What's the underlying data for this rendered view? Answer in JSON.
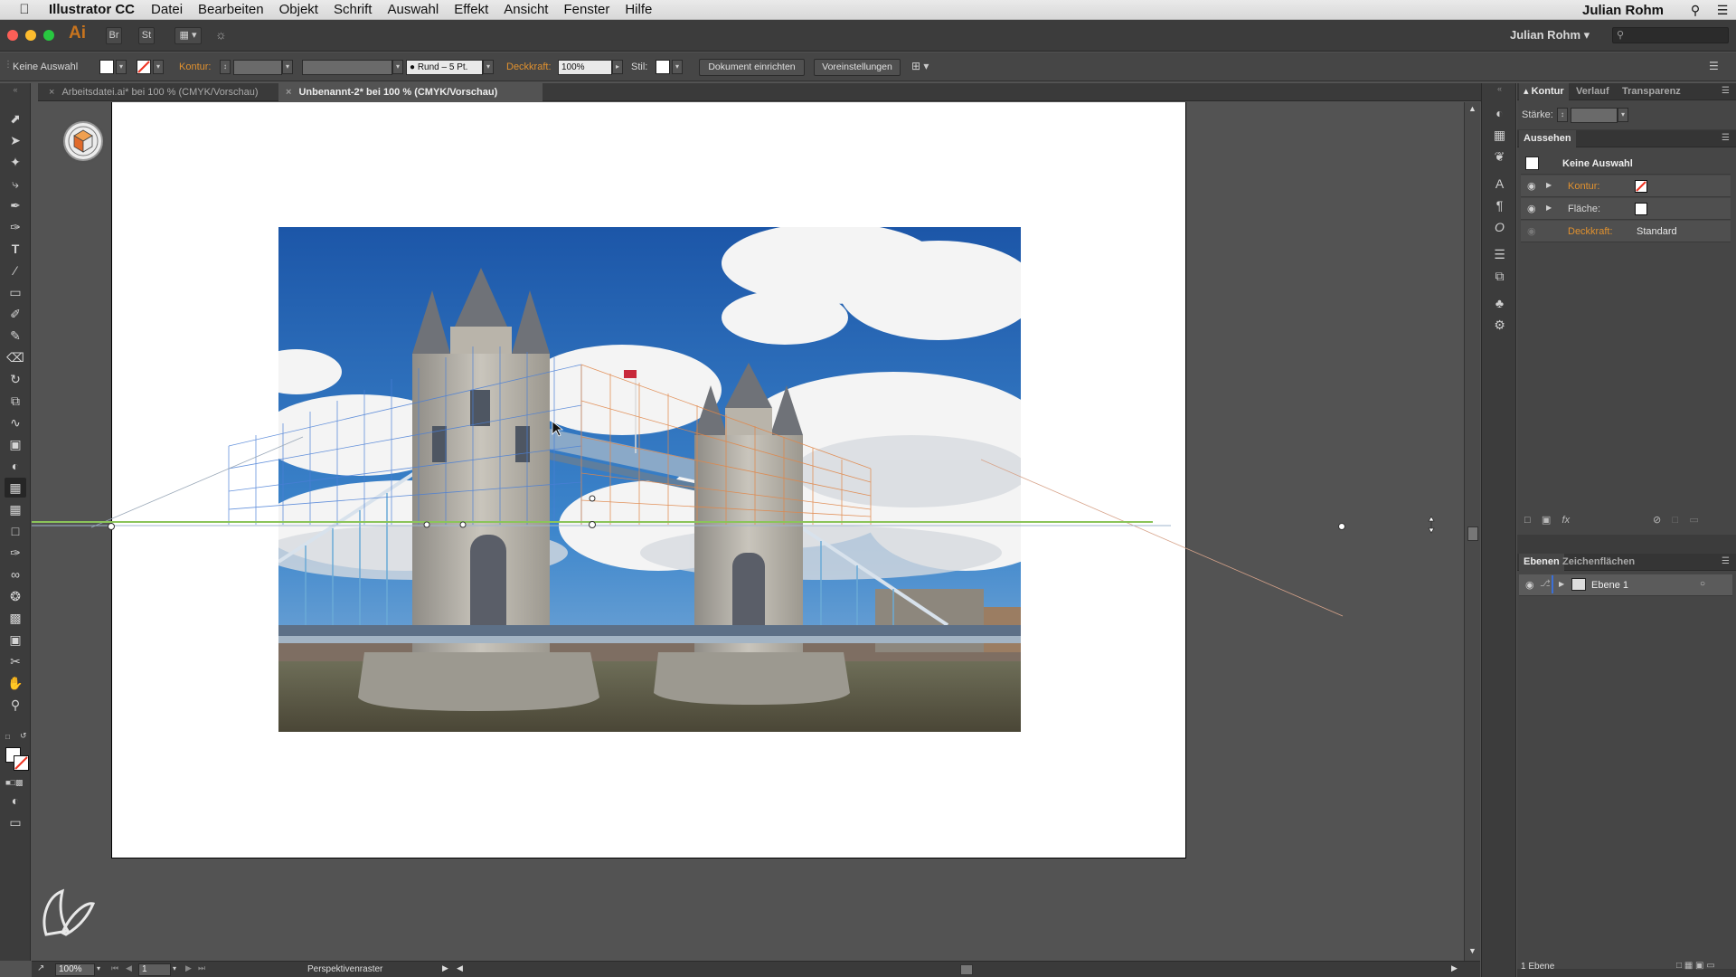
{
  "menubar": {
    "app_name": "Illustrator CC",
    "items": [
      "Datei",
      "Bearbeiten",
      "Objekt",
      "Schrift",
      "Auswahl",
      "Effekt",
      "Ansicht",
      "Fenster",
      "Hilfe"
    ],
    "user": "Julian Rohm"
  },
  "appbar": {
    "logo": "Ai",
    "bridge_label": "Br",
    "stock_label": "St",
    "username": "Julian Rohm"
  },
  "controlbar": {
    "selection": "Keine Auswahl",
    "stroke_label": "Kontur:",
    "brush": "Rund – 5 Pt.",
    "opacity_label": "Deckkraft:",
    "opacity_value": "100%",
    "style_label": "Stil:",
    "doc_setup_button": "Dokument einrichten",
    "preferences_button": "Voreinstellungen"
  },
  "tabs": [
    {
      "label": "Arbeitsdatei.ai* bei 100 % (CMYK/Vorschau)",
      "active": false
    },
    {
      "label": "Unbenannt-2* bei 100 % (CMYK/Vorschau)",
      "active": true
    }
  ],
  "statusbar": {
    "zoom": "100%",
    "page": "1",
    "tool_name": "Perspektivenraster"
  },
  "panels": {
    "top_tabs": [
      "Kontur",
      "Verlauf",
      "Transparenz"
    ],
    "stroke_weight_label": "Stärke:",
    "appearance_title": "Aussehen",
    "appearance_selection": "Keine Auswahl",
    "appearance_rows": [
      {
        "label": "Kontur:",
        "value": ""
      },
      {
        "label": "Fläche:",
        "value": ""
      },
      {
        "label": "Deckkraft:",
        "value": "Standard"
      }
    ],
    "layers_tabs": [
      "Ebenen",
      "Zeichenflächen"
    ],
    "layers": [
      {
        "name": "Ebene 1"
      }
    ],
    "layer_count": "1 Ebene"
  },
  "colors": {
    "accent_orange": "#e0912f",
    "ui_dark": "#3c3c3c",
    "canvas_gray": "#535353",
    "horizon_green": "#8bc45a",
    "grid_blue": "#4a7fd6",
    "grid_orange": "#e0874a"
  }
}
